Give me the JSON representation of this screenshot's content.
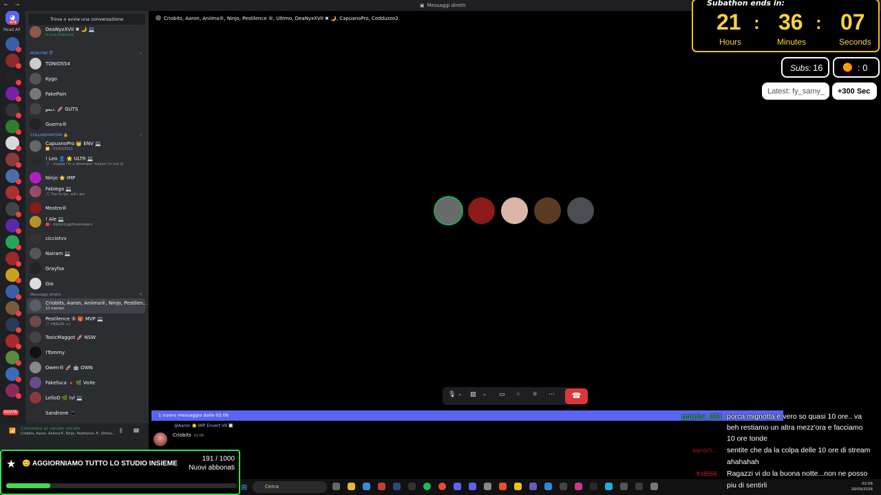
{
  "window": {
    "title": "Messaggi diretti"
  },
  "rail": {
    "home_badge": "479",
    "read_all": "Read All",
    "novita": "NOVITÀ"
  },
  "sidebar": {
    "find_placeholder": "Trova o avvia una conversazione",
    "top_user": {
      "name": "DeaNyxXVII ✖ 🌙 💻",
      "status": "In una chiamata"
    },
    "section_mon_fre": "MON FRE 😈",
    "section_collab": "COLLABORATORI 🔒",
    "section_dm": "Messaggi diretti",
    "group1": [
      {
        "name": "TONIO554"
      },
      {
        "name": "Kygo"
      },
      {
        "name": "FakePain"
      },
      {
        "name": "ديمو. 🚀 GUTS"
      },
      {
        "name": "Guerra®"
      }
    ],
    "group2": [
      {
        "name": "CapuanoPro 👑 ENV 💻",
        "status": "🔁 - 03/03/2021"
      },
      {
        "name": "! Leo 👤 🌟 ULTR 💻",
        "status": "🎵 - maybe i'm a developer maybe i'm not 😊"
      },
      {
        "name": "Ninjo ⭐ IMP"
      },
      {
        "name": "Fabiega 💻",
        "status": "🎵 The Script, will.i.am"
      },
      {
        "name": "Mostro®"
      },
      {
        "name": "! Ale 💻",
        "status": "🔴 - discord.gg/freeviewers"
      },
      {
        "name": "cicciotvv"
      },
      {
        "name": "Nairam 💻"
      },
      {
        "name": "Grayfox"
      },
      {
        "name": "Gio"
      }
    ],
    "dms": [
      {
        "name": "Criobits, Aaron, Aniima®, Ninjo, Pestilen...",
        "status": "10 membri"
      },
      {
        "name": "Pestilence ® 🎁 MVP 💻",
        "status": "🎵 HEALER +1"
      },
      {
        "name": "ToxicMaggot 🚀 NSW"
      },
      {
        "name": "!Tommy"
      },
      {
        "name": "Owen® 🚀 🤖 OWN"
      },
      {
        "name": "Fakefuca 🔺 🌿 VoXe"
      },
      {
        "name": "LelloD 🌿 lvl 💻"
      },
      {
        "name": "Sandrone 📱"
      }
    ]
  },
  "voice": {
    "title": "Connesso al canale vocale",
    "subtitle": "Criobits, Aaron, Aniima®, Ninjo, Pestilence ®, Ultimo..."
  },
  "call": {
    "header": "Criobits, Aaron, Aniima®, Ninjo, Pestilence ®, Ultimo, DeaNyxXVII ✖ 🌙, CapuanoPro, Cedduzzo2",
    "participant_colors": [
      "#6a6a6a",
      "#8b1a1a",
      "#d9b6a8",
      "#5a3b22",
      "#4a4d52"
    ]
  },
  "messages": {
    "new_bar": "1 nuovo messaggio dalle 02:06",
    "reply_to": "@Aaron 🌟 IMP Envert V9 🔲",
    "author": "Criobits",
    "time": "02:06"
  },
  "subathon": {
    "title": "Subathon ends in:",
    "hours": "21",
    "minutes": "36",
    "seconds": "07",
    "hours_label": "Hours",
    "minutes_label": "Minutes",
    "seconds_label": "Seconds",
    "subs_label": "Subs:",
    "subs_value": "16",
    "bits_value": ": 0",
    "latest": "Latest: fy_samy_",
    "bonus": "+300 Sec"
  },
  "goal": {
    "title": "😊 AGGIORNIAMO TUTTO LO STUDIO INSIEME",
    "value": "191 / 1000",
    "label": "Nuovi abbonati",
    "progress": 0.191
  },
  "chat": [
    {
      "user": "grayfox_861",
      "text": "porca mignotta è vero so quasi 10 ore.. va"
    },
    {
      "user": "",
      "text": "beh restiamo un altra mezz'ora e facciamo"
    },
    {
      "user": "",
      "text": "10 ore tonde"
    },
    {
      "user": "aandr0...",
      "text": "sentite che da la colpa delle 10 ore di stream"
    },
    {
      "user": "",
      "text": "ahahahah"
    },
    {
      "user": "frx8666",
      "text": "Ragazzi vi do la buona notte...non ne posso"
    },
    {
      "user": "",
      "text": "piu di sentirli"
    }
  ],
  "taskbar": {
    "search": "Cerca",
    "time": "02:08",
    "date": "18/09/2026"
  }
}
